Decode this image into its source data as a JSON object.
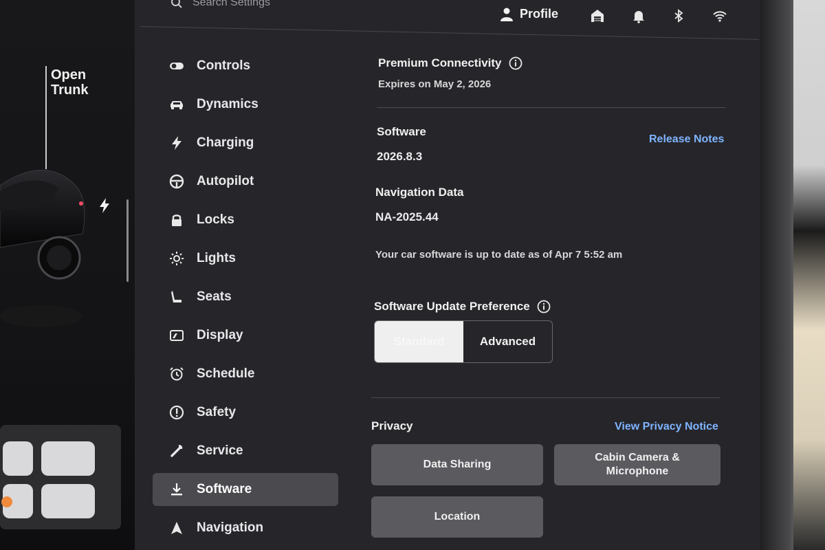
{
  "car_panel": {
    "trunk_label_line1": "Open",
    "trunk_label_line2": "Trunk",
    "charge_icon": "bolt-icon"
  },
  "header": {
    "search_placeholder": "Search Settings",
    "profile_label": "Profile",
    "icons": [
      "search-icon",
      "person-icon",
      "garage-icon",
      "bell-icon",
      "bluetooth-icon",
      "wifi-icon"
    ]
  },
  "nav": {
    "items": [
      {
        "label": "Controls",
        "icon": "toggle-icon"
      },
      {
        "label": "Dynamics",
        "icon": "car-icon"
      },
      {
        "label": "Charging",
        "icon": "bolt-icon"
      },
      {
        "label": "Autopilot",
        "icon": "steering-wheel-icon"
      },
      {
        "label": "Locks",
        "icon": "lock-icon"
      },
      {
        "label": "Lights",
        "icon": "sun-icon"
      },
      {
        "label": "Seats",
        "icon": "seat-icon"
      },
      {
        "label": "Display",
        "icon": "display-icon"
      },
      {
        "label": "Schedule",
        "icon": "alarm-clock-icon"
      },
      {
        "label": "Safety",
        "icon": "alert-circle-icon"
      },
      {
        "label": "Service",
        "icon": "wrench-icon"
      },
      {
        "label": "Software",
        "icon": "download-icon",
        "active": true
      },
      {
        "label": "Navigation",
        "icon": "navigation-arrow-icon"
      }
    ]
  },
  "content": {
    "connectivity": {
      "title": "Premium Connectivity",
      "expires": "Expires on May 2, 2026"
    },
    "software": {
      "label": "Software",
      "version": "2026.8.3",
      "release_notes": "Release Notes"
    },
    "navigation_data": {
      "label": "Navigation Data",
      "version": "NA-2025.44"
    },
    "status_text": "Your car software is up to date as of Apr 7 5:52 am",
    "update_preference": {
      "title": "Software Update Preference",
      "options": [
        "Standard",
        "Advanced"
      ],
      "selected": "Standard"
    },
    "privacy": {
      "title": "Privacy",
      "notice_link": "View Privacy Notice",
      "buttons": {
        "data_sharing": "Data Sharing",
        "cabin_camera_line1": "Cabin Camera &",
        "cabin_camera_line2": "Microphone",
        "location": "Location"
      }
    }
  },
  "colors": {
    "screen_bg": "#26262a",
    "active_nav_bg": "#4a4a4f",
    "link": "#7fb4ff",
    "button_bg": "#5a5a5f"
  }
}
